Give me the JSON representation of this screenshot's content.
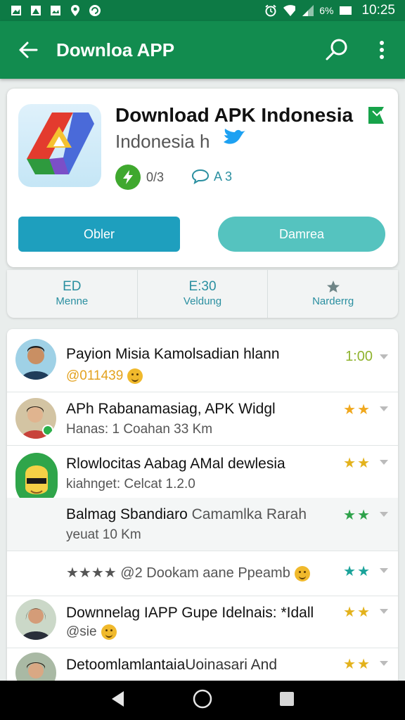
{
  "status_bar": {
    "battery_pct": "6%",
    "time": "10:25",
    "left_icons": [
      "gallery-icon",
      "photo-icon",
      "image-icon",
      "location-icon",
      "refresh-icon"
    ],
    "right_icons": [
      "alarm-icon",
      "wifi-icon",
      "signal-icon",
      "battery-icon"
    ]
  },
  "app_bar": {
    "title": "Downloa APP",
    "back_icon": "arrow-back-icon",
    "search_icon": "search-icon",
    "more_icon": "more-vert-icon",
    "color": "#128c4f"
  },
  "app_card": {
    "title": "Download APK Indonesia",
    "subtitle": "Indonesia h",
    "meta_left": "0/3",
    "meta_right": "A 3",
    "button_primary": "Obler",
    "button_secondary": "Damrea"
  },
  "tabs": [
    {
      "top": "ED",
      "bottom": "Menne"
    },
    {
      "top": "E:30",
      "bottom": "Veldung"
    },
    {
      "top": "",
      "bottom": "Narderrg"
    }
  ],
  "list": [
    {
      "line1": "Payion Misia Kamolsadian hlann",
      "line2": "@011439",
      "right": "1:00",
      "stars": 0,
      "star_color": ""
    },
    {
      "line1": "APh Rabanamasiag, APK Widgl",
      "line2": "Hanas: 1 Coahan 33 Km",
      "stars": 2,
      "star_color": "#f0a81e"
    },
    {
      "line1": "Rlowlocitas Aabag AMal dewlesia",
      "line2": "kiahnget: Celcat 1.2.0",
      "stars": 2,
      "star_color": "#e3b21c"
    },
    {
      "line1": "Balmag Sbandiaro",
      "line1b": "Camamlka Rarah",
      "line2": "yeuat 10 Km",
      "stars": 2,
      "star_color": "#2ea24a"
    },
    {
      "line1": "★★★★ @2 Dookam aane Ppeamb",
      "line2": "",
      "stars": 2,
      "star_color": "#1aa39a"
    },
    {
      "line1": "Downnelag IAPP Gupe Idelnais: *Idall",
      "line2": "@sie",
      "stars": 2,
      "star_color": "#e3b21c"
    },
    {
      "line1": "Detoomlamlantaia",
      "line1b": "Uoinasari And",
      "line2": "",
      "stars": 2,
      "star_color": "#e3b21c"
    }
  ],
  "nav_bar": {
    "icons": [
      "back-triangle-icon",
      "home-circle-icon",
      "recents-square-icon"
    ]
  }
}
